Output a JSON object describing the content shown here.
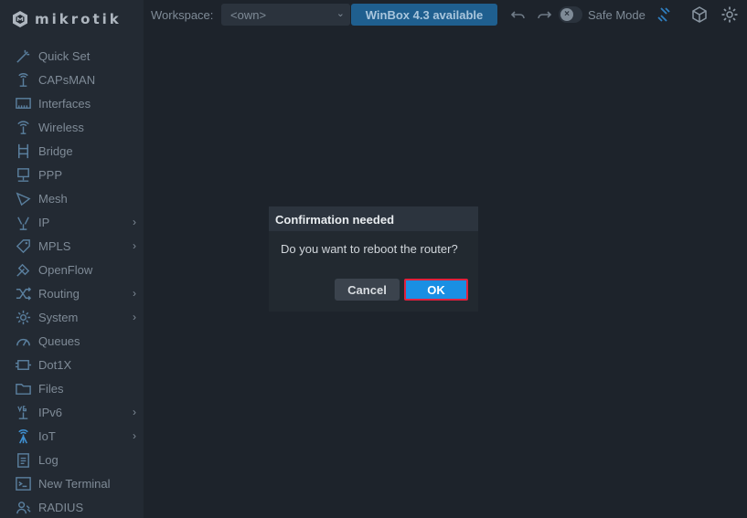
{
  "brand": {
    "name": "MikroTik",
    "logo_text": "mikrotik"
  },
  "topbar": {
    "workspace_label": "Workspace:",
    "workspace_value": "<own>",
    "update_label": "WinBox 4.3 available",
    "safe_mode_label": "Safe Mode",
    "icons": [
      "undo-icon",
      "redo-icon",
      "safe-mode-toggle",
      "safe-mode-status-icon",
      "package-icon",
      "gear-icon"
    ]
  },
  "sidebar": {
    "items": [
      {
        "label": "Quick Set",
        "icon": "wand-icon",
        "submenu": false
      },
      {
        "label": "CAPsMAN",
        "icon": "antenna-icon",
        "submenu": false
      },
      {
        "label": "Interfaces",
        "icon": "interfaces-icon",
        "submenu": false
      },
      {
        "label": "Wireless",
        "icon": "wireless-icon",
        "submenu": false
      },
      {
        "label": "Bridge",
        "icon": "bridge-icon",
        "submenu": false
      },
      {
        "label": "PPP",
        "icon": "ppp-icon",
        "submenu": false
      },
      {
        "label": "Mesh",
        "icon": "mesh-icon",
        "submenu": false
      },
      {
        "label": "IP",
        "icon": "ip-icon",
        "submenu": true
      },
      {
        "label": "MPLS",
        "icon": "tag-icon",
        "submenu": true
      },
      {
        "label": "OpenFlow",
        "icon": "openflow-icon",
        "submenu": false
      },
      {
        "label": "Routing",
        "icon": "routing-icon",
        "submenu": true
      },
      {
        "label": "System",
        "icon": "system-gear-icon",
        "submenu": true
      },
      {
        "label": "Queues",
        "icon": "queues-icon",
        "submenu": false
      },
      {
        "label": "Dot1X",
        "icon": "dot1x-icon",
        "submenu": false
      },
      {
        "label": "Files",
        "icon": "folder-icon",
        "submenu": false
      },
      {
        "label": "IPv6",
        "icon": "ipv6-icon",
        "submenu": true
      },
      {
        "label": "IoT",
        "icon": "iot-icon",
        "submenu": true
      },
      {
        "label": "Log",
        "icon": "log-icon",
        "submenu": false
      },
      {
        "label": "New Terminal",
        "icon": "terminal-icon",
        "submenu": false
      },
      {
        "label": "RADIUS",
        "icon": "radius-icon",
        "submenu": false
      }
    ]
  },
  "dialog": {
    "title": "Confirmation needed",
    "message": "Do you want to reboot the router?",
    "cancel_label": "Cancel",
    "ok_label": "OK"
  },
  "colors": {
    "background": "#1d232b",
    "sidebar": "#232a33",
    "accent": "#1a8fe3",
    "update_button": "#1f5f8f",
    "highlight_border": "#e0213d"
  }
}
